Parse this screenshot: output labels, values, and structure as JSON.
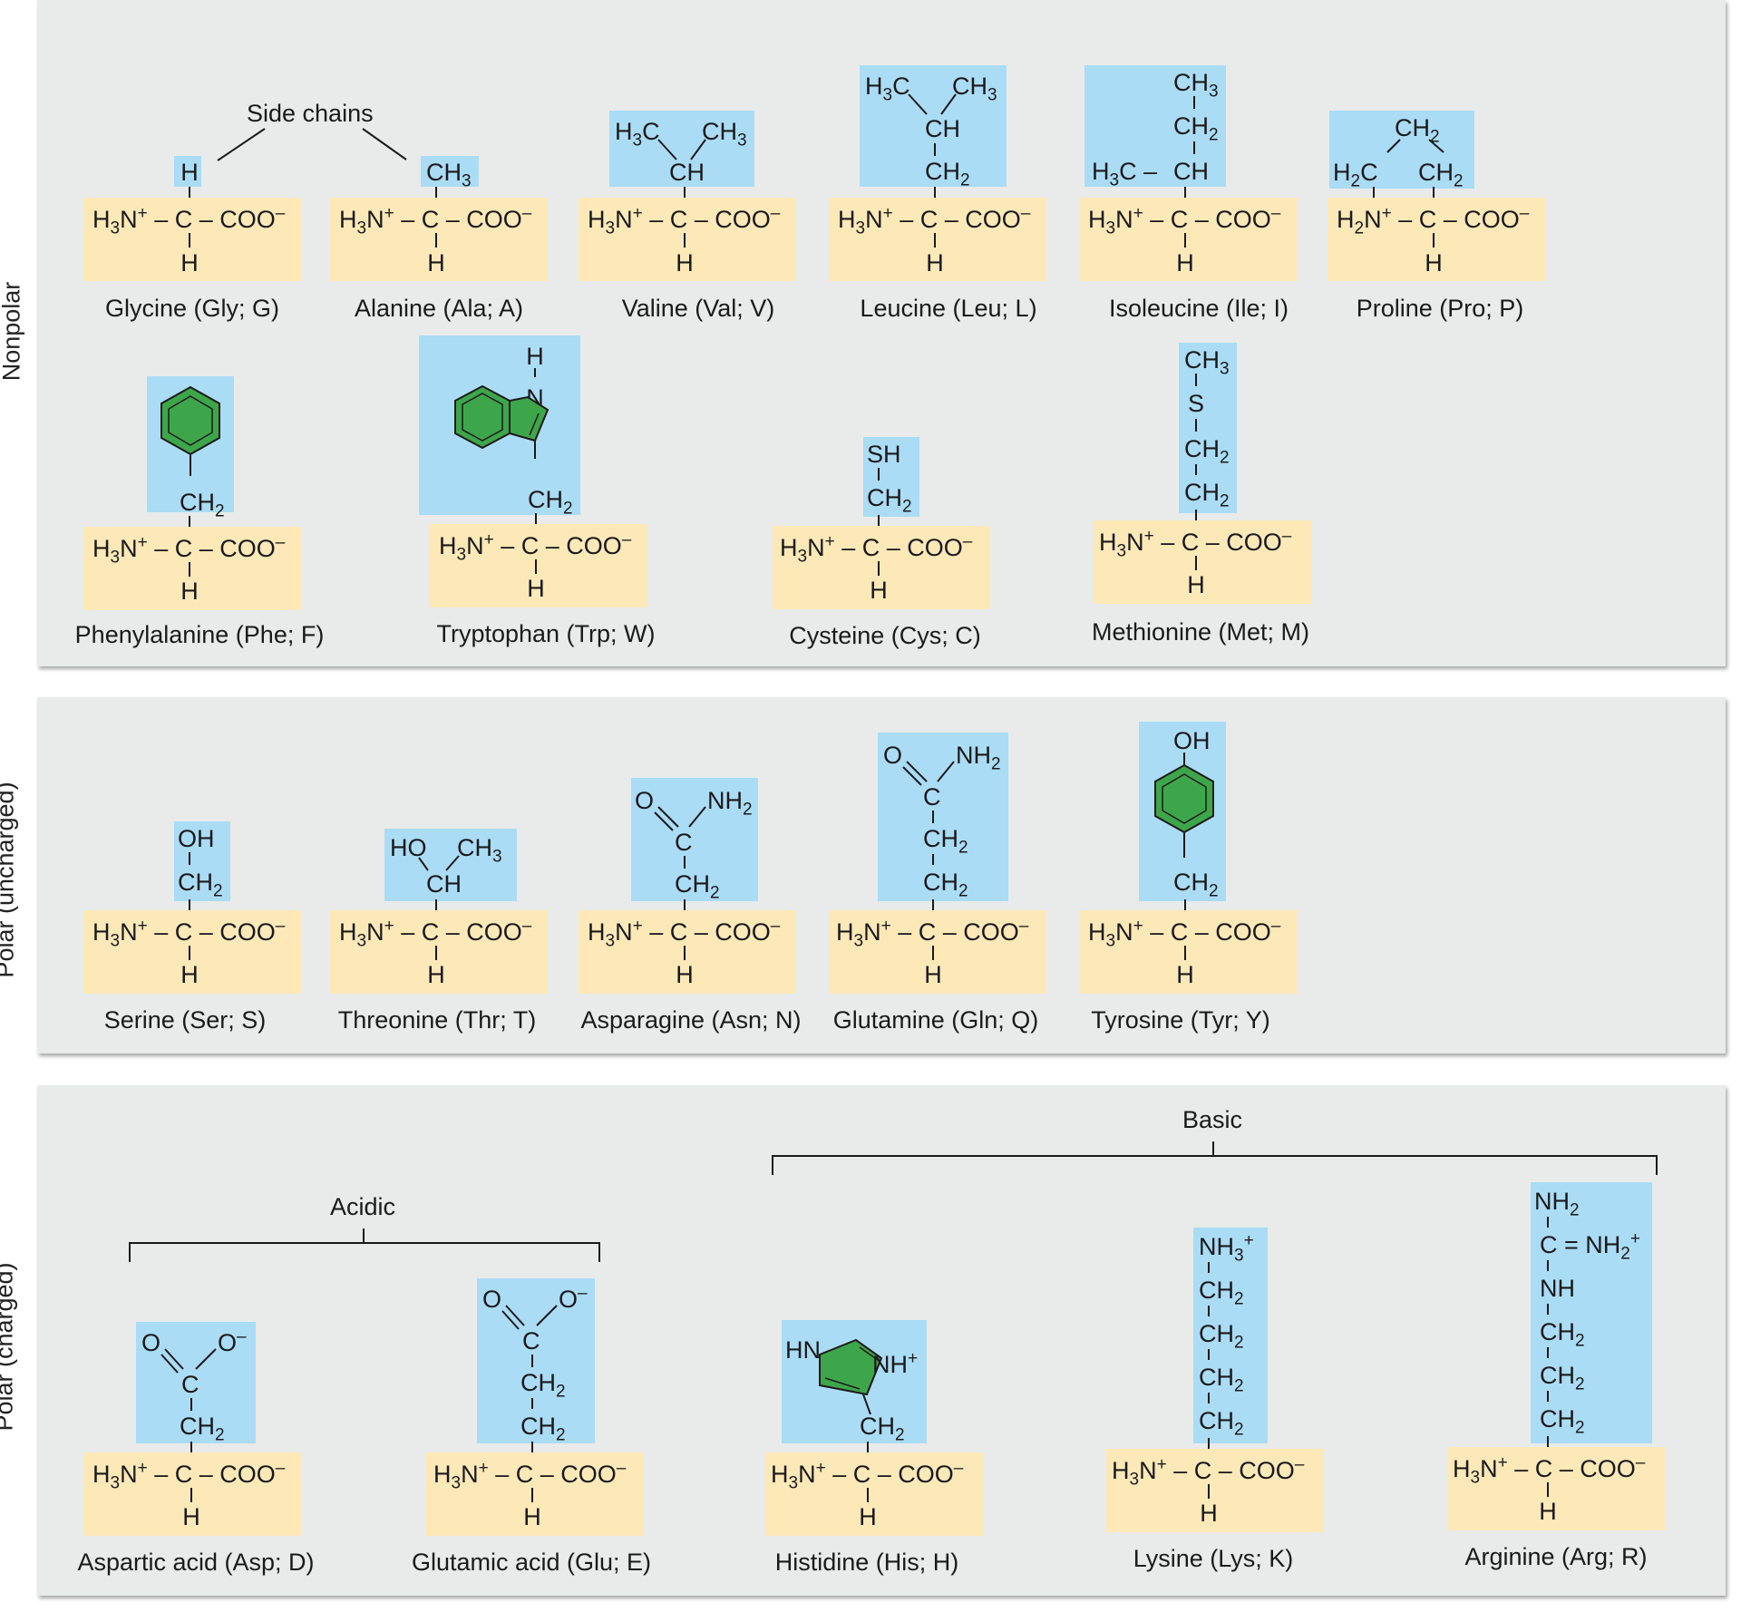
{
  "panels": {
    "nonpolar": "Nonpolar",
    "polar_uncharged": "Polar (uncharged)",
    "polar_charged": "Polar (charged)"
  },
  "annotations": {
    "side_chains": "Side chains",
    "acidic": "Acidic",
    "basic": "Basic"
  },
  "amino_acids": [
    {
      "name": "Glycine (Gly; G)"
    },
    {
      "name": "Alanine (Ala; A)"
    },
    {
      "name": "Valine (Val; V)"
    },
    {
      "name": "Leucine (Leu; L)"
    },
    {
      "name": "Isoleucine (Ile; I)"
    },
    {
      "name": "Proline (Pro; P)"
    },
    {
      "name": "Phenylalanine (Phe; F)"
    },
    {
      "name": "Tryptophan (Trp; W)"
    },
    {
      "name": "Cysteine (Cys; C)"
    },
    {
      "name": "Methionine (Met; M)"
    },
    {
      "name": "Serine (Ser; S)"
    },
    {
      "name": "Threonine (Thr; T)"
    },
    {
      "name": "Asparagine (Asn; N)"
    },
    {
      "name": "Glutamine (Gln; Q)"
    },
    {
      "name": "Tyrosine (Tyr; Y)"
    },
    {
      "name": "Aspartic acid (Asp; D)"
    },
    {
      "name": "Glutamic acid (Glu; E)"
    },
    {
      "name": "Histidine (His; H)"
    },
    {
      "name": "Lysine (Lys; K)"
    },
    {
      "name": "Arginine (Arg; R)"
    }
  ],
  "colors": {
    "backbone_fill": "#fde8b8",
    "side_chain_fill": "#aadcf6",
    "ring_fill": "#3da64a",
    "panel_bg": "#e8ebe9"
  }
}
